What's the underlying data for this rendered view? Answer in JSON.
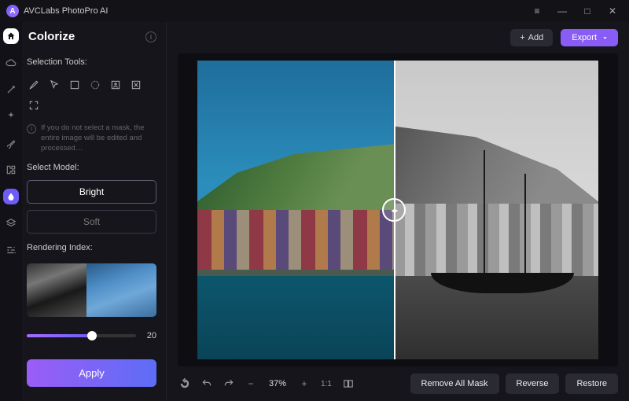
{
  "app": {
    "title": "AVCLabs PhotoPro AI"
  },
  "window": {
    "menu": "≡",
    "min": "—",
    "max": "□",
    "close": "✕"
  },
  "topbar": {
    "add": "Add",
    "add_icon": "+",
    "export": "Export"
  },
  "rail": {
    "items": [
      {
        "name": "home-icon",
        "active": "home"
      },
      {
        "name": "cloud-icon"
      },
      {
        "name": "magic-wand-icon"
      },
      {
        "name": "sparkle-icon"
      },
      {
        "name": "brush-icon"
      },
      {
        "name": "puzzle-icon"
      },
      {
        "name": "drop-icon",
        "active": "active"
      },
      {
        "name": "layers-icon"
      },
      {
        "name": "sliders-icon"
      }
    ]
  },
  "sidebar": {
    "title": "Colorize",
    "selection_label": "Selection Tools:",
    "hint": "If you do not select a mask, the entire image will be edited and processed…",
    "model_label": "Select Model:",
    "models": {
      "bright": "Bright",
      "soft": "Soft"
    },
    "rendering_label": "Rendering Index:",
    "rendering_value": "20",
    "apply": "Apply"
  },
  "viewer": {
    "zoom_pct": "37%",
    "ratio": "1:1",
    "remove_mask": "Remove All Mask",
    "reverse": "Reverse",
    "restore": "Restore"
  }
}
